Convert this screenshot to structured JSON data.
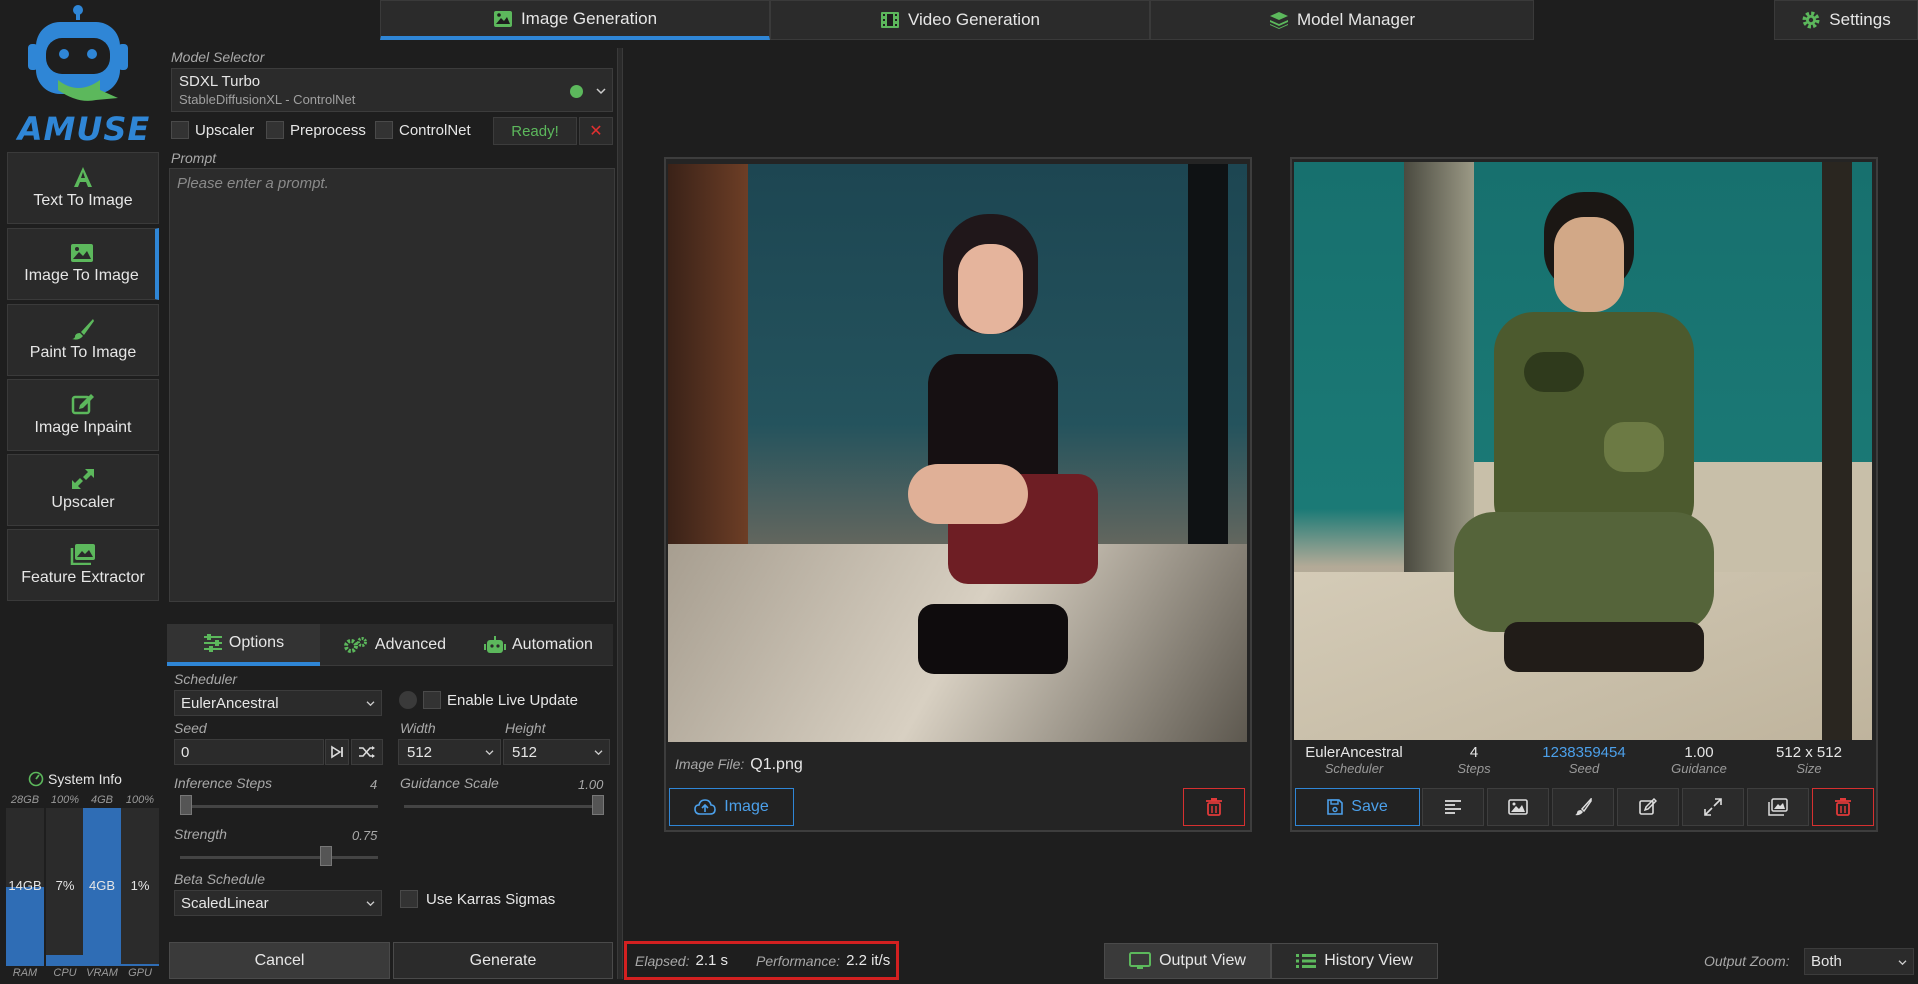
{
  "app": {
    "logo_text": "AMUSE"
  },
  "top_tabs": [
    {
      "label": "Image Generation",
      "icon": "image-icon",
      "active": true
    },
    {
      "label": "Video Generation",
      "icon": "film-icon",
      "active": false
    },
    {
      "label": "Model Manager",
      "icon": "layers-icon",
      "active": false
    }
  ],
  "settings": {
    "label": "Settings",
    "icon": "gear-icon"
  },
  "nav": [
    {
      "label": "Text To Image",
      "icon": "letter-a-icon"
    },
    {
      "label": "Image To Image",
      "icon": "image-icon",
      "active": true
    },
    {
      "label": "Paint To Image",
      "icon": "brush-icon"
    },
    {
      "label": "Image Inpaint",
      "icon": "edit-icon"
    },
    {
      "label": "Upscaler",
      "icon": "expand-arrows-icon"
    },
    {
      "label": "Feature Extractor",
      "icon": "images-icon"
    }
  ],
  "model_selector": {
    "label": "Model Selector",
    "name": "SDXL Turbo",
    "sub": "StableDiffusionXL - ControlNet",
    "status_color": "#5cb85c"
  },
  "toggles": {
    "upscaler": "Upscaler",
    "preprocess": "Preprocess",
    "controlnet": "ControlNet"
  },
  "ready_label": "Ready!",
  "close_label": "✕",
  "prompt": {
    "label": "Prompt",
    "placeholder": "Please enter a prompt."
  },
  "option_tabs": [
    {
      "label": "Options",
      "active": true
    },
    {
      "label": "Advanced"
    },
    {
      "label": "Automation"
    }
  ],
  "options": {
    "scheduler_label": "Scheduler",
    "scheduler_value": "EulerAncestral",
    "live_update_label": "Enable Live Update",
    "seed_label": "Seed",
    "seed_value": "0",
    "width_label": "Width",
    "width_value": "512",
    "height_label": "Height",
    "height_value": "512",
    "inference_label": "Inference Steps",
    "inference_value": "4",
    "inference_fraction": 0.0,
    "guidance_label": "Guidance Scale",
    "guidance_value": "1.00",
    "guidance_fraction": 1.0,
    "strength_label": "Strength",
    "strength_value": "0.75",
    "strength_fraction": 0.75,
    "beta_label": "Beta Schedule",
    "beta_value": "ScaledLinear",
    "karras_label": "Use Karras Sigmas"
  },
  "actions": {
    "cancel": "Cancel",
    "generate": "Generate"
  },
  "system_info": {
    "title": "System Info",
    "bars": [
      {
        "top": "28GB",
        "value": "14GB",
        "label": "RAM",
        "fraction": 0.5
      },
      {
        "top": "100%",
        "value": "7%",
        "label": "CPU",
        "fraction": 0.07
      },
      {
        "top": "4GB",
        "value": "4GB",
        "label": "VRAM",
        "fraction": 1.0
      },
      {
        "top": "100%",
        "value": "1%",
        "label": "GPU",
        "fraction": 0.01
      }
    ]
  },
  "input_panel": {
    "file_label": "Image File:",
    "file_name": "Q1.png",
    "image_button": "Image"
  },
  "output_panel": {
    "meta": [
      {
        "value": "EulerAncestral",
        "label": "Scheduler"
      },
      {
        "value": "4",
        "label": "Steps"
      },
      {
        "value": "1238359454",
        "label": "Seed",
        "link": true
      },
      {
        "value": "1.00",
        "label": "Guidance"
      },
      {
        "value": "512 x 512",
        "label": "Size"
      }
    ],
    "save_label": "Save"
  },
  "status": {
    "elapsed_label": "Elapsed:",
    "elapsed_value": "2.1 s",
    "perf_label": "Performance:",
    "perf_value": "2.2 it/s"
  },
  "views": {
    "output": "Output View",
    "history": "History View"
  },
  "zoom": {
    "label": "Output Zoom:",
    "value": "Both"
  }
}
